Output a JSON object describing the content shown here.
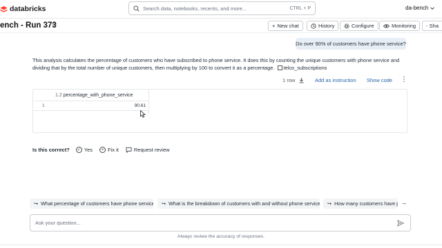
{
  "app": {
    "logo_text": "databricks",
    "workspace": "da-bench",
    "search": {
      "placeholder": "Search data, notebooks, recents, and more...",
      "shortcut": "CTRL + P"
    }
  },
  "title": "ench - Run 373",
  "toolbar": {
    "new_chat": "New chat",
    "history": "History",
    "configure": "Configure",
    "monitoring": "Monitoring",
    "share": "Sha"
  },
  "conversation": {
    "user_message": "Do over 90% of customers have phone service?",
    "answer_text": "This analysis calculates the percentage of customers who have subscribed to phone service. It does this by counting the unique customers with phone service and dividing that by the total number of unique customers, then multiplying by 100 to convert it as a percentage.",
    "table_ref": "telco_subscriptions",
    "result_meta": {
      "rows": "1 row",
      "add_instruction": "Add as instruction",
      "show_code": "Show code"
    },
    "result_table": {
      "column_type": "1.2",
      "column": "percentage_with_phone_service",
      "rows": [
        {
          "index": "1",
          "value": "90.61"
        }
      ]
    },
    "feedback": {
      "label": "Is this correct?",
      "yes": "Yes",
      "fix": "Fix it",
      "review": "Request review"
    }
  },
  "suggestions": [
    "What percentage of customers have phone service?",
    "What is the breakdown of customers with and without phone service?",
    "How many customers have ph"
  ],
  "input": {
    "placeholder": "Ask your question..."
  },
  "disclaimer": "Always review the accuracy of responses.",
  "colors": {
    "accent": "#2563a8",
    "user_bubble": "#e8eef6",
    "brand": "#ff3621"
  }
}
